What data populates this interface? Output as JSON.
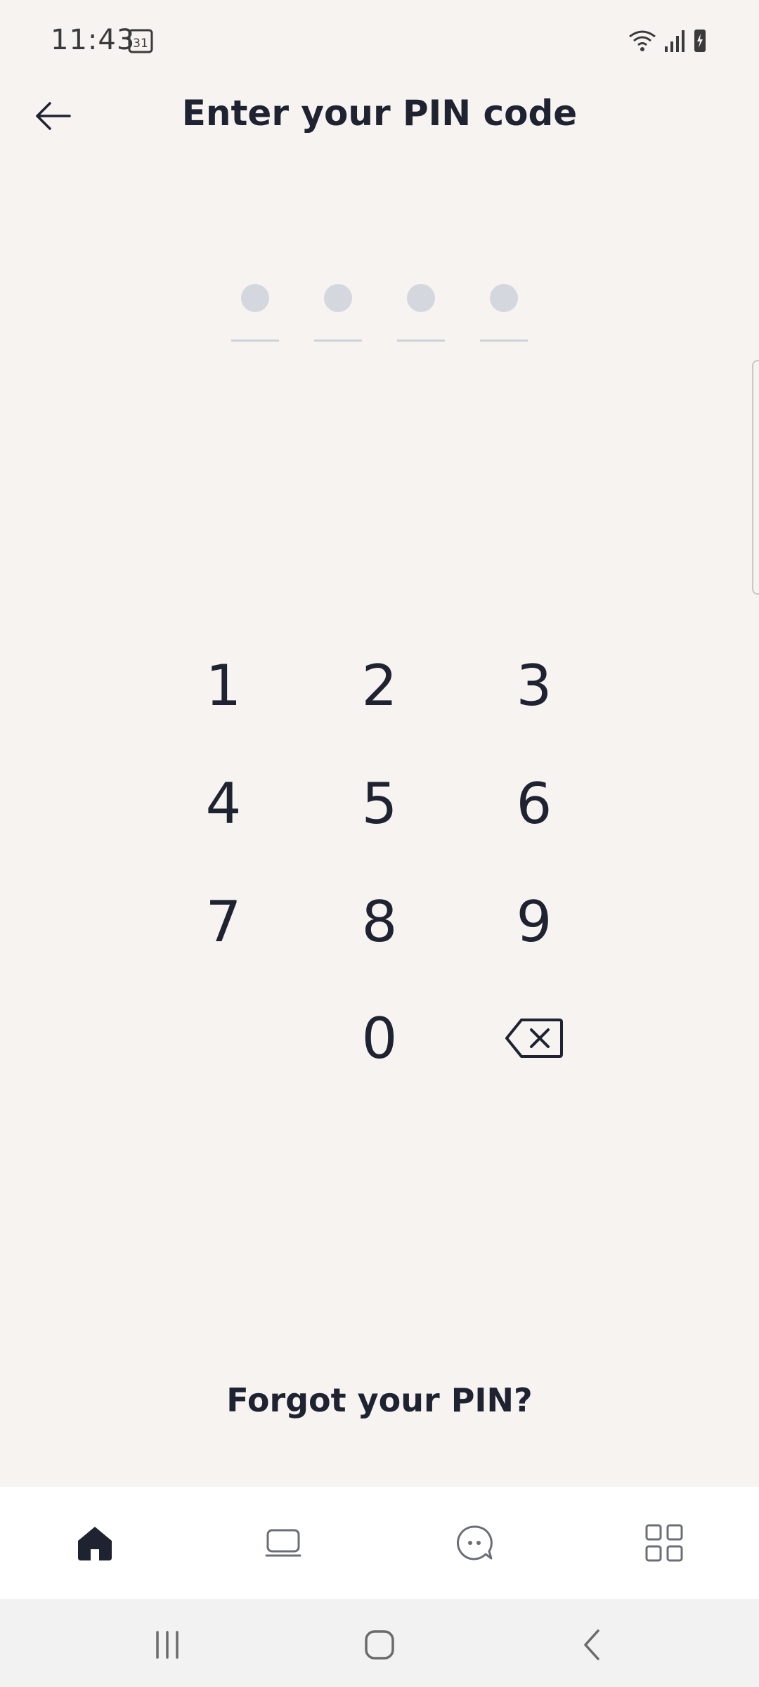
{
  "status_bar": {
    "time": "11:43",
    "calendar_day": "31"
  },
  "header": {
    "title": "Enter your PIN code"
  },
  "pin": {
    "length": 4,
    "entered": 0
  },
  "keypad": {
    "keys": [
      "1",
      "2",
      "3",
      "4",
      "5",
      "6",
      "7",
      "8",
      "9",
      "0"
    ]
  },
  "footer": {
    "forgot_label": "Forgot your PIN?"
  },
  "bottom_nav": {
    "items": [
      "home-icon",
      "device-icon",
      "chat-icon",
      "grid-icon"
    ],
    "active": "home-icon"
  },
  "colors": {
    "background": "#f6f3f1",
    "text": "#1f2230",
    "pin_dot": "#d4d7de"
  }
}
